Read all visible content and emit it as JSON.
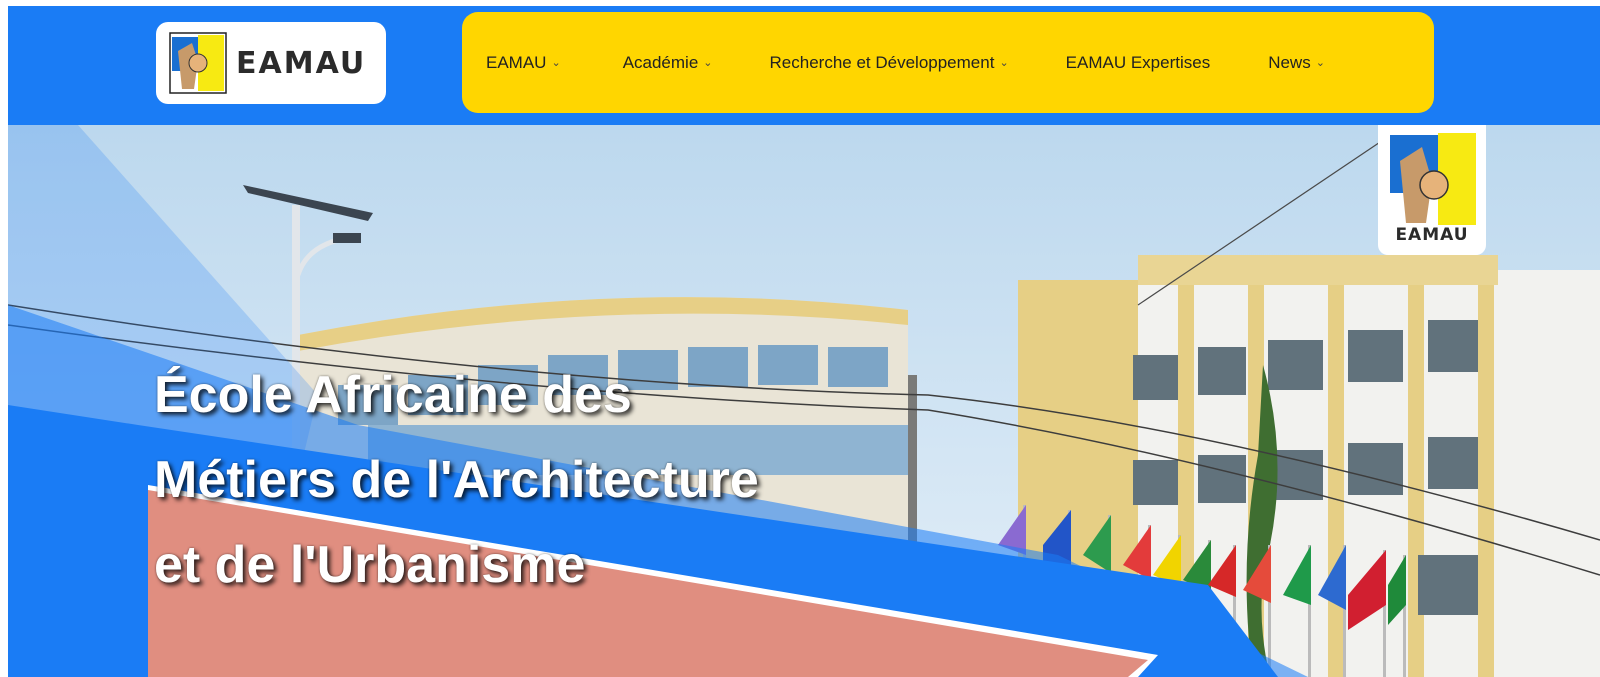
{
  "header": {
    "logo_text": "EAMAU",
    "nav": [
      {
        "label": "EAMAU",
        "has_dropdown": true,
        "icon": "chevron-down-icon"
      },
      {
        "label": "Académie",
        "has_dropdown": true,
        "icon": "chevron-down-icon"
      },
      {
        "label": "Recherche et Développement",
        "has_dropdown": true,
        "icon": "chevron-down-icon"
      },
      {
        "label": "EAMAU Expertises",
        "has_dropdown": false
      },
      {
        "label": "News",
        "has_dropdown": true,
        "icon": "chevron-down-icon"
      }
    ]
  },
  "hero": {
    "title_lines": [
      "École Africaine des",
      "Métiers de l'Architecture",
      "et de l'Urbanisme"
    ],
    "corner_logo_text": "EAMAU"
  },
  "colors": {
    "header_blue": "#1a7cf5",
    "nav_yellow": "#ffd600",
    "accent_salmon": "#e08e80"
  }
}
